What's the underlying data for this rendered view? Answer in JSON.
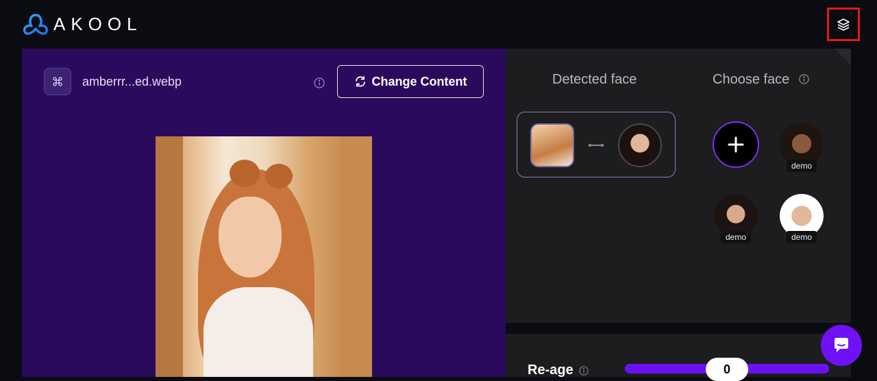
{
  "header": {
    "brand": "AKOOL",
    "layers_icon": "layers-icon"
  },
  "left": {
    "file_name": "amberrr...ed.webp",
    "change_content_label": "Change Content",
    "file_icon": "command-icon"
  },
  "right": {
    "detected_face_title": "Detected face",
    "choose_face_title": "Choose face",
    "demo_faces": [
      {
        "tag": "demo"
      },
      {
        "tag": "demo"
      },
      {
        "tag": "demo"
      }
    ]
  },
  "bottom": {
    "reage_label": "Re-age",
    "reage_value": "0"
  },
  "colors": {
    "accent_purple": "#7011f5",
    "left_panel_bg": "#2a0a5c",
    "highlight_red": "#e01b1b"
  }
}
